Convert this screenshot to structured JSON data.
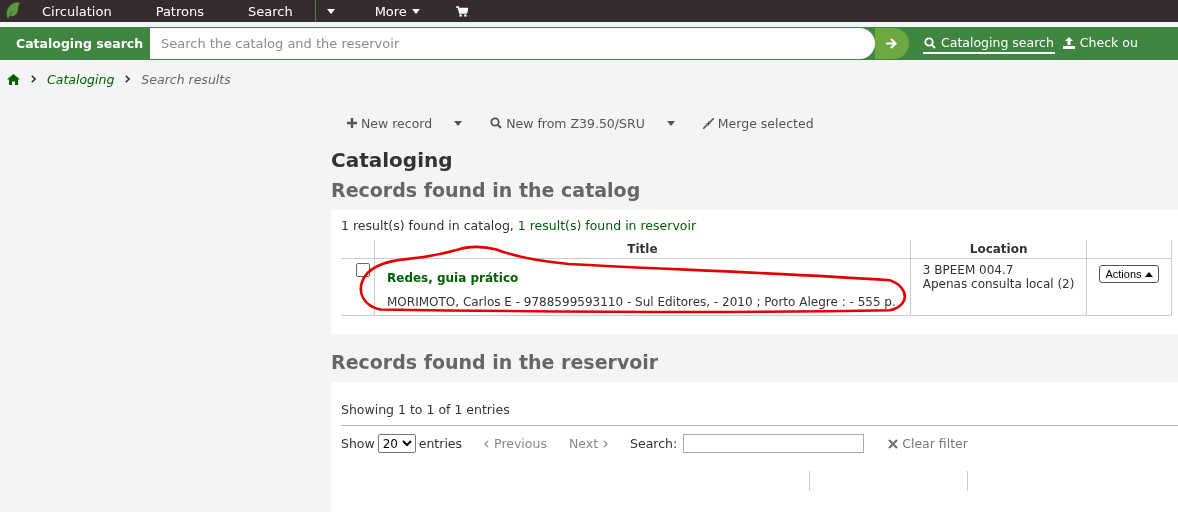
{
  "topnav": {
    "items": [
      "Circulation",
      "Patrons",
      "Search"
    ],
    "more": "More"
  },
  "searchbar": {
    "tab": "Cataloging search",
    "placeholder": "Search the catalog and the reservoir",
    "links": [
      {
        "label": "Cataloging search",
        "kind": "search",
        "selected": true
      },
      {
        "label": "Check ou",
        "kind": "checkout",
        "selected": false
      }
    ]
  },
  "breadcrumb": [
    "Cataloging",
    "Search results"
  ],
  "toolbar": [
    {
      "label": "New record",
      "kind": "new",
      "dropdown": true
    },
    {
      "label": "New from Z39.50/SRU",
      "kind": "search",
      "dropdown": true
    },
    {
      "label": "Merge selected",
      "kind": "merge",
      "dropdown": false
    }
  ],
  "heading": "Cataloging",
  "catalog": {
    "heading": "Records found in the catalog",
    "summary": "1 result(s) found in catalog, ",
    "summary_link": "1 result(s) found in reservoir",
    "columns": [
      "Title",
      "Location"
    ],
    "rows": [
      {
        "checked": false,
        "title": "Redes, guia prático",
        "details": "MORIMOTO, Carlos E - 9788599593110 - Sul Editores, - 2010 ; Porto Alegre : - 555 p.",
        "location": [
          "3 BPEEM 004.7",
          "Apenas consulta local (2)"
        ],
        "action": "Actions"
      }
    ]
  },
  "reservoir": {
    "heading": "Records found in the reservoir",
    "info": "Showing 1 to 1 of 1 entries",
    "show_label": "Show",
    "page_size": "20",
    "entries_label": "entries",
    "pager": [
      {
        "label": "Previous",
        "disabled": true
      },
      {
        "label": "Next",
        "disabled": true
      }
    ],
    "search_label": "Search:",
    "clear": "Clear filter"
  }
}
